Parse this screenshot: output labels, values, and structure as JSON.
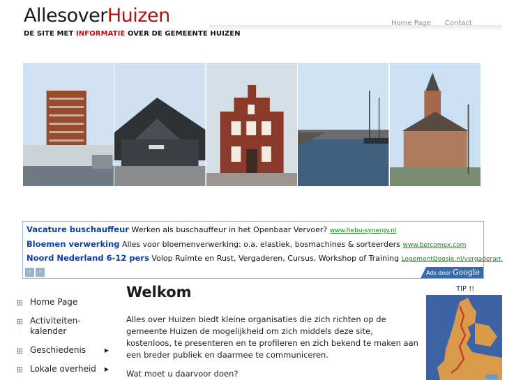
{
  "header": {
    "logo_part1": "Allesover",
    "logo_part2": "Huizen",
    "tagline_pre": "DE SITE MET ",
    "tagline_highlight": "INFORMATIE",
    "tagline_post": " OVER DE GEMEENTE HUIZEN",
    "nav": [
      "Home Page",
      "Contact"
    ]
  },
  "colors": {
    "brand_red": "#b01010",
    "ad_title_blue": "#0b3fa8",
    "ad_url_green": "#0a8a10",
    "menu_bullet_blue": "#23429a"
  },
  "ads": {
    "items": [
      {
        "title": "Vacature buschauffeur",
        "desc": "Werken als buschauffeur in het Openbaar Vervoer?",
        "url": "www.hebu-synergy.nl"
      },
      {
        "title": "Bloemen verwerking",
        "desc": "Alles voor bloemenverwerking: o.a. elastiek, bosmachines & sorteerders",
        "url": "www.bercomex.com"
      },
      {
        "title": "Noord Nederland 6-12 pers",
        "desc": "Volop Ruimte en Rust, Vergaderen, Cursus, Workshop of Training",
        "url": "LogementDoosje.nl/vergaderarr."
      }
    ],
    "ads_by_prefix": "Ads door ",
    "ads_by_brand": "Google",
    "prev_glyph": "‹",
    "next_glyph": "›"
  },
  "sidemenu": [
    {
      "label": "Home Page",
      "has_submenu": false
    },
    {
      "label": "Activiteiten-kalender",
      "has_submenu": false
    },
    {
      "label": "Geschiedenis",
      "has_submenu": true
    },
    {
      "label": "Lokale overheid",
      "has_submenu": true
    }
  ],
  "content": {
    "title": "Welkom",
    "paragraph1": "Alles over Huizen biedt kleine organisaties die zich richten op de gemeente Huizen de mogelijkheid om zich middels deze site, kostenloos, te presenteren en te profileren en zich bekend te maken aan een breder publiek en daarmee te communiceren.",
    "paragraph2": "Wat moet u daarvoor doen?"
  },
  "tip": {
    "label": "TIP !!"
  }
}
